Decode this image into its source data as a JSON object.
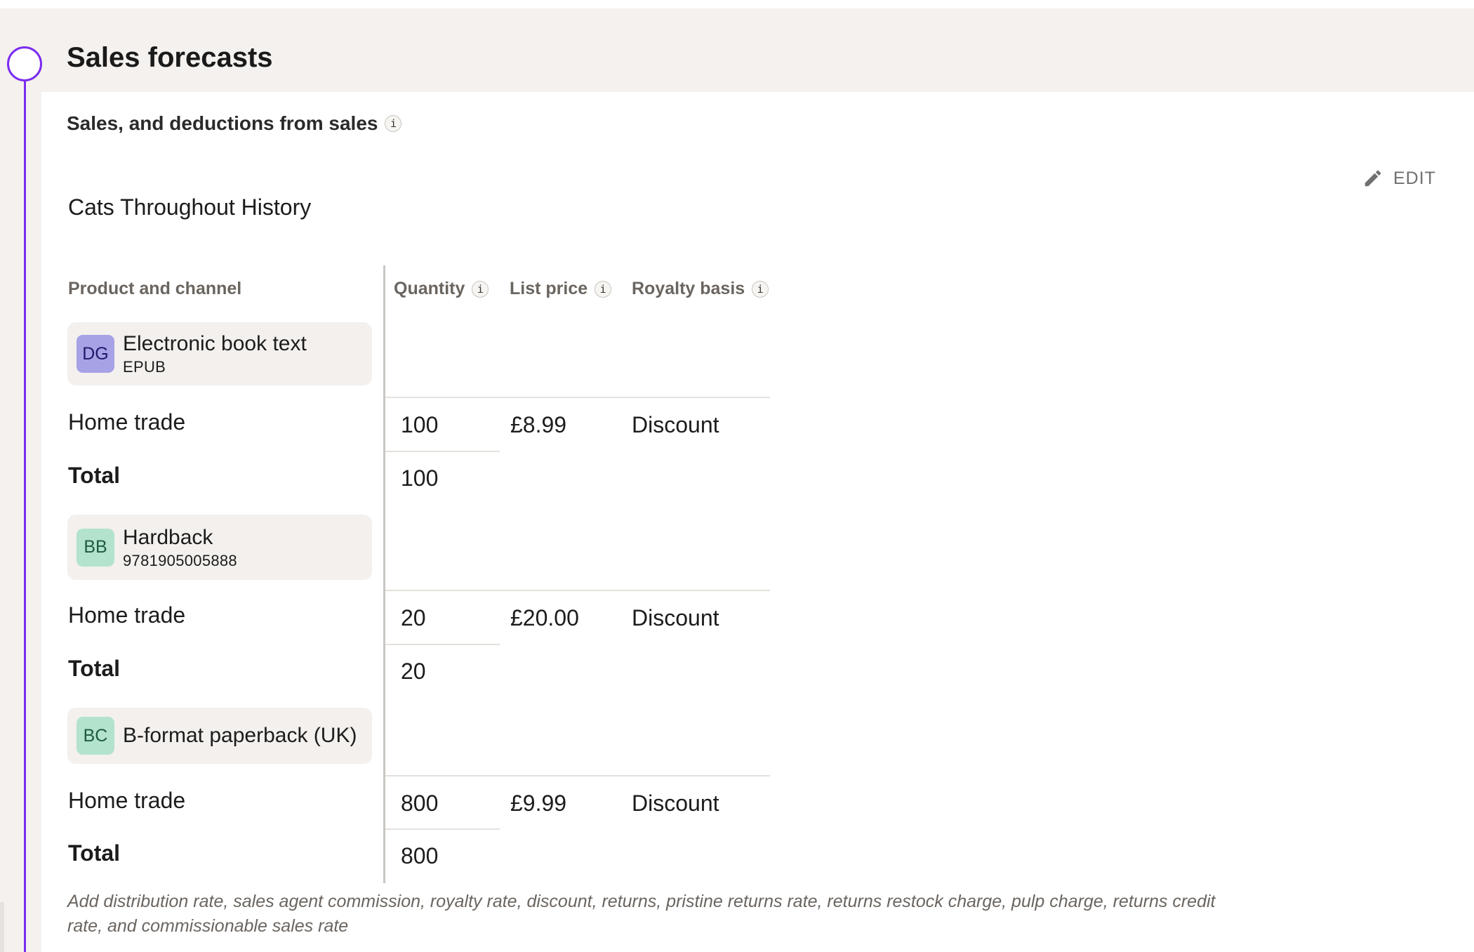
{
  "section": {
    "title": "Sales forecasts",
    "subheading": "Sales, and deductions from sales",
    "info_glyph": "i"
  },
  "edit_label": "EDIT",
  "book_title": "Cats Throughout History",
  "columns": {
    "product": "Product and channel",
    "quantity": "Quantity",
    "list_price": "List price",
    "royalty_basis": "Royalty basis"
  },
  "products": [
    {
      "badge": "DG",
      "badge_bg": "#a7a1e6",
      "badge_fg": "#1d1a6b",
      "name": "Electronic book text",
      "subtitle": "EPUB",
      "channel": "Home trade",
      "quantity": "100",
      "list_price": "£8.99",
      "royalty_basis": "Discount",
      "total_label": "Total",
      "total_quantity": "100"
    },
    {
      "badge": "BB",
      "badge_bg": "#b3e3cd",
      "badge_fg": "#1f5a41",
      "name": "Hardback",
      "subtitle": "9781905005888",
      "channel": "Home trade",
      "quantity": "20",
      "list_price": "£20.00",
      "royalty_basis": "Discount",
      "total_label": "Total",
      "total_quantity": "20"
    },
    {
      "badge": "BC",
      "badge_bg": "#b3e3cd",
      "badge_fg": "#1f5a41",
      "name": "B-format paperback (UK)",
      "subtitle": "",
      "channel": "Home trade",
      "quantity": "800",
      "list_price": "£9.99",
      "royalty_basis": "Discount",
      "total_label": "Total",
      "total_quantity": "800"
    }
  ],
  "footnote": "Add distribution rate, sales agent commission, royalty rate, discount, returns, pristine returns rate, returns restock charge, pulp charge, returns credit rate, and commissionable sales rate",
  "icons": {
    "edit": "pencil-icon",
    "info": "info-icon",
    "timeline": "timeline-step-icon"
  },
  "colors": {
    "accent": "#7b2cf0",
    "page_bg": "#f4f1ee",
    "card_bg": "#f3f0ed",
    "muted_text": "#6b6560"
  }
}
